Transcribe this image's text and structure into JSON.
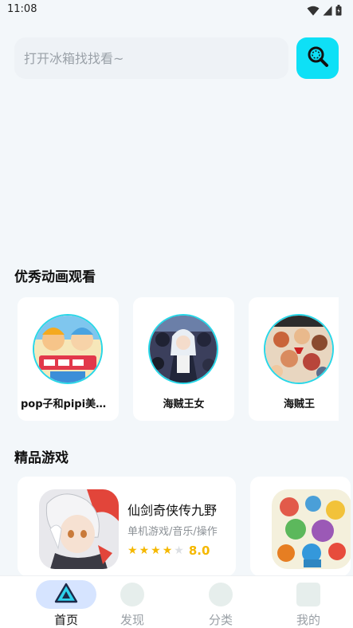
{
  "status_bar": {
    "time": "11:08"
  },
  "search": {
    "placeholder": "打开冰箱找找看~",
    "button_icon": "search-icon"
  },
  "sections": {
    "anime_title": "优秀动画观看",
    "games_title": "精品游戏"
  },
  "anime": [
    {
      "name": "pop子和pipi美的日常"
    },
    {
      "name": "海贼王女"
    },
    {
      "name": "海贼王"
    }
  ],
  "games": [
    {
      "title": "仙剑奇侠传九野",
      "tags": "单机游戏/音乐/操作",
      "rating": "8.0",
      "stars": 4,
      "max_stars": 5
    },
    {
      "title": "",
      "tags": "",
      "rating": ""
    }
  ],
  "tabs": [
    {
      "label": "首页",
      "icon": "home-triangle-icon",
      "active": true
    },
    {
      "label": "发现",
      "icon": "discover-icon",
      "active": false
    },
    {
      "label": "分类",
      "icon": "category-icon",
      "active": false
    },
    {
      "label": "我的",
      "icon": "profile-icon",
      "active": false
    }
  ],
  "colors": {
    "accent": "#0ee0f6",
    "rating": "#f5b800",
    "active_tab_bg": "#d6e4ff",
    "tab_label": "#9aa0a6"
  }
}
